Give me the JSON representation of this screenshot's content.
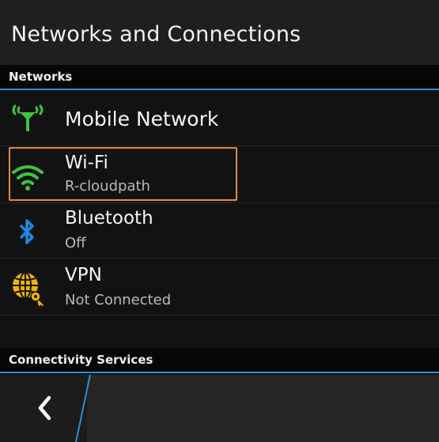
{
  "header": {
    "title": "Networks and Connections"
  },
  "sections": {
    "networks": "Networks",
    "connectivity": "Connectivity Services"
  },
  "items": [
    {
      "id": "mobile",
      "label": "Mobile Network",
      "icon": "antenna-icon",
      "color": "#3fc43b"
    },
    {
      "id": "wifi",
      "label": "Wi-Fi",
      "subtitle": "R-cloudpath",
      "icon": "wifi-icon",
      "color": "#3fc43b",
      "focused": true
    },
    {
      "id": "bluetooth",
      "label": "Bluetooth",
      "subtitle": "Off",
      "icon": "bluetooth-icon",
      "color": "#1e88e5"
    },
    {
      "id": "vpn",
      "label": "VPN",
      "subtitle": "Not Connected",
      "icon": "globe-key-icon",
      "color": "#f0b400"
    }
  ],
  "actionbar": {
    "back_icon": "chevron-left-icon"
  },
  "colors": {
    "accent": "#2a8fd8",
    "focus": "#e58a3c"
  }
}
